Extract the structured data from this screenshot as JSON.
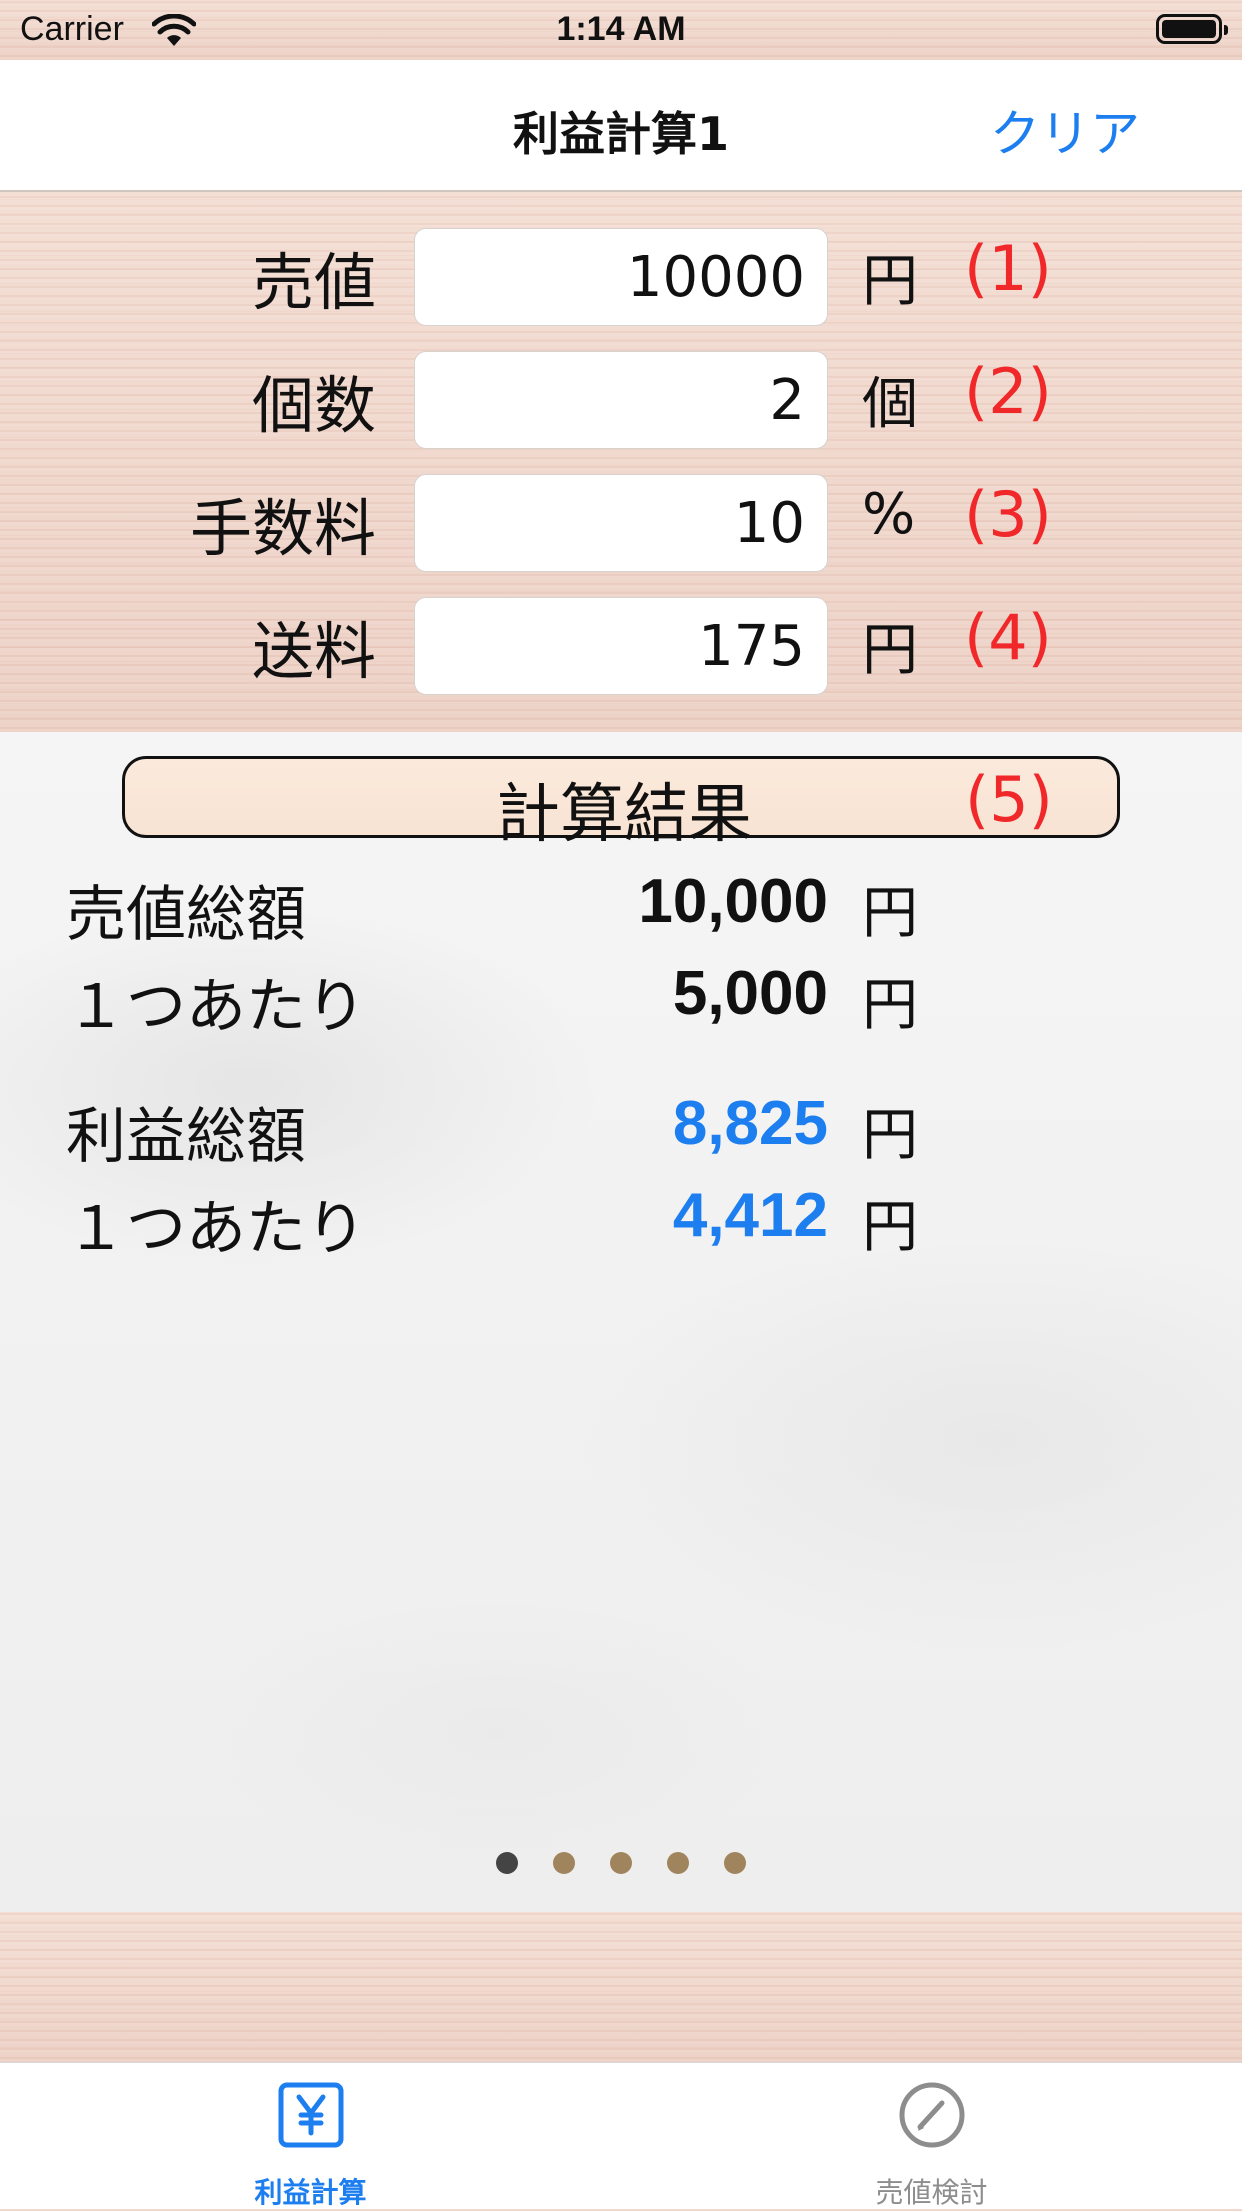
{
  "status_bar": {
    "carrier": "Carrier",
    "time": "1:14 AM"
  },
  "nav": {
    "title": "利益計算1",
    "clear_label": "クリア"
  },
  "inputs": [
    {
      "label": "売値",
      "value": "10000",
      "unit": "円",
      "num": "(1)"
    },
    {
      "label": "個数",
      "value": "2",
      "unit": "個",
      "num": "(2)"
    },
    {
      "label": "手数料",
      "value": "10",
      "unit": "%",
      "num": "(3)"
    },
    {
      "label": "送料",
      "value": "175",
      "unit": "円",
      "num": "(4)"
    }
  ],
  "results": {
    "header": "計算結果",
    "header_num": "(5)",
    "rows": [
      {
        "label": "売値総額",
        "value": "10,000",
        "unit": "円"
      },
      {
        "label": "１つあたり",
        "value": "5,000",
        "unit": "円"
      },
      {
        "label": "利益総額",
        "value": "8,825",
        "unit": "円"
      },
      {
        "label": "１つあたり",
        "value": "4,412",
        "unit": "円"
      }
    ]
  },
  "page_indicator": {
    "count": 5,
    "active": 0
  },
  "tabs": [
    {
      "label": "利益計算",
      "icon": "yen-icon",
      "selected": true
    },
    {
      "label": "売値検討",
      "icon": "pencil-circle-icon",
      "selected": false
    }
  ],
  "colors": {
    "accent": "#1d7ef0",
    "number_red": "#f0282a"
  }
}
